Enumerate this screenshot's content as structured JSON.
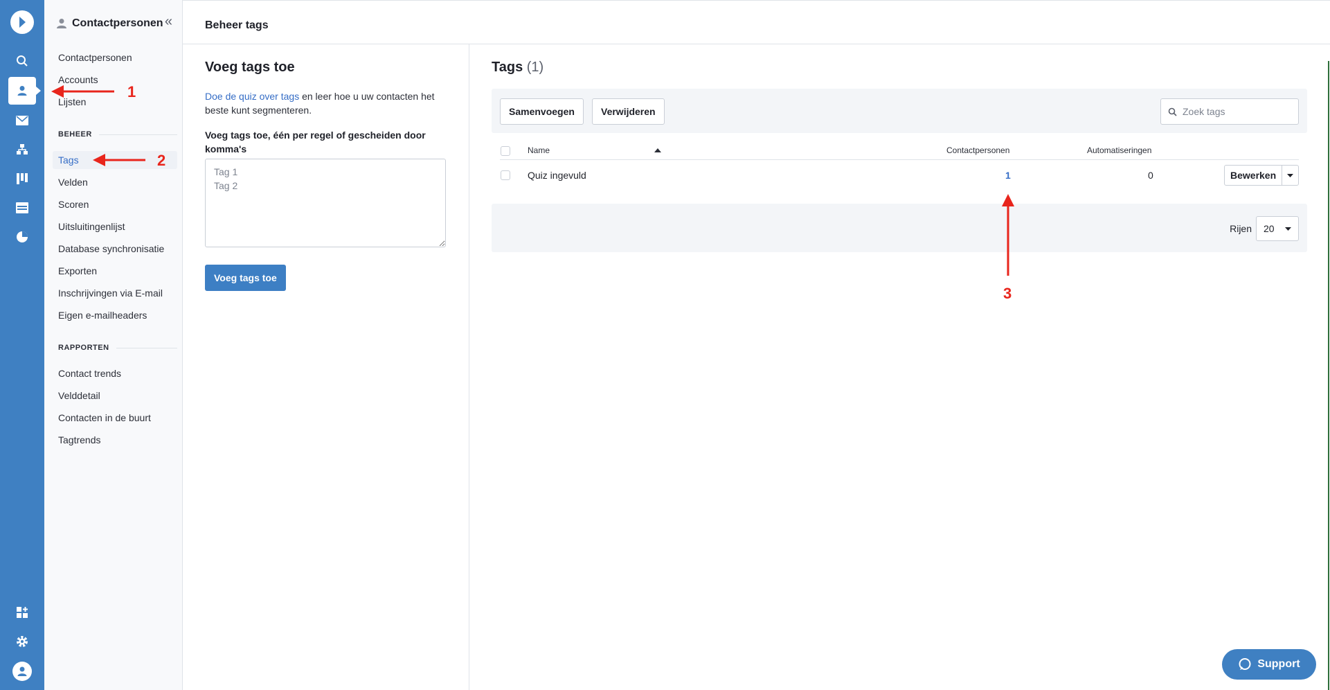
{
  "sidebar": {
    "title": "Contactpersonen",
    "collapse_icon": "«",
    "items_top": [
      "Contactpersonen",
      "Accounts",
      "Lijsten"
    ],
    "section_beheer": "BEHEER",
    "items_beheer": [
      "Tags",
      "Velden",
      "Scoren",
      "Uitsluitingenlijst",
      "Database synchronisatie",
      "Exporten",
      "Inschrijvingen via E-mail",
      "Eigen e-mailheaders"
    ],
    "section_rapporten": "RAPPORTEN",
    "items_rapporten": [
      "Contact trends",
      "Velddetail",
      "Contacten in de buurt",
      "Tagtrends"
    ]
  },
  "rail": {
    "icons": [
      "logo-icon",
      "search-icon",
      "contacts-icon",
      "email-icon",
      "automation-icon",
      "deals-icon",
      "site-icon",
      "reports-icon",
      "apps-icon",
      "settings-icon",
      "user-avatar-icon"
    ]
  },
  "header": {
    "title": "Beheer tags"
  },
  "add_panel": {
    "title": "Voeg tags toe",
    "intro_link": "Doe de quiz over tags",
    "intro_text": " en leer hoe u uw contacten het beste kunt segmenteren.",
    "label": "Voeg tags toe, één per regel of gescheiden door komma's",
    "placeholder": "Tag 1\nTag 2",
    "button": "Voeg tags toe"
  },
  "tags_panel": {
    "title": "Tags",
    "count": "(1)",
    "merge_button": "Samenvoegen",
    "delete_button": "Verwijderen",
    "search_placeholder": "Zoek tags",
    "columns": [
      "Name",
      "Contactpersonen",
      "Automatiseringen"
    ],
    "rows": [
      {
        "name": "Quiz ingevuld",
        "contacts": "1",
        "automations": "0",
        "action": "Bewerken"
      }
    ],
    "rows_label": "Rijen",
    "rows_value": "20"
  },
  "annotations": [
    "1",
    "2",
    "3"
  ],
  "support_button": "Support",
  "colors": {
    "brand": "#3f80c2",
    "link": "#356dc6",
    "annotation": "#e8251c"
  }
}
